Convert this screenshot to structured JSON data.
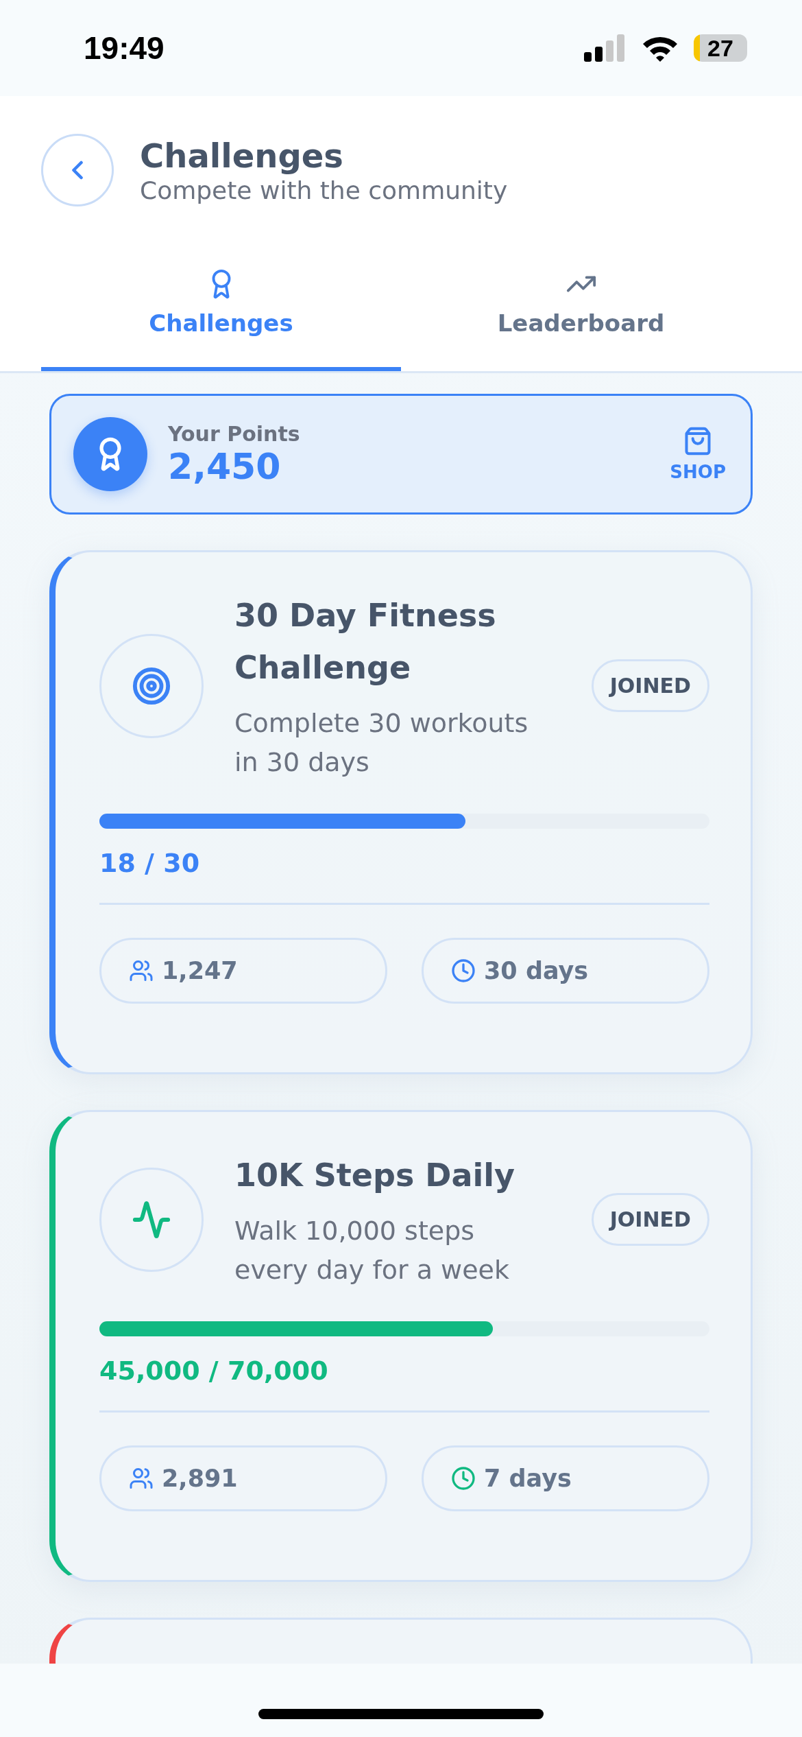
{
  "status_bar": {
    "time": "19:49",
    "battery": "27"
  },
  "header": {
    "title": "Challenges",
    "subtitle": "Compete with the community"
  },
  "tabs": [
    {
      "label": "Challenges",
      "selected": true
    },
    {
      "label": "Leaderboard",
      "selected": false
    }
  ],
  "points": {
    "label": "Your Points",
    "value": "2,450",
    "shop": "SHOP"
  },
  "cards": [
    {
      "title": "30 Day Fitness Challenge",
      "description": "Complete 30 workouts in 30 days",
      "kind": "target",
      "badge": "JOINED",
      "color": "#3b82f6",
      "level": 0.6,
      "progress": "18 / 30",
      "participants": "1,247",
      "duration": "30 days"
    },
    {
      "title": "10K Steps Daily",
      "description": "Walk 10,000 steps every day for a week",
      "kind": "activity",
      "badge": "JOINED",
      "color": "#10b981",
      "level": 0.645,
      "progress": "45,000 / 70,000",
      "participants": "2,891",
      "duration": "7 days"
    }
  ],
  "next_card": {
    "color": "#ef4444"
  }
}
